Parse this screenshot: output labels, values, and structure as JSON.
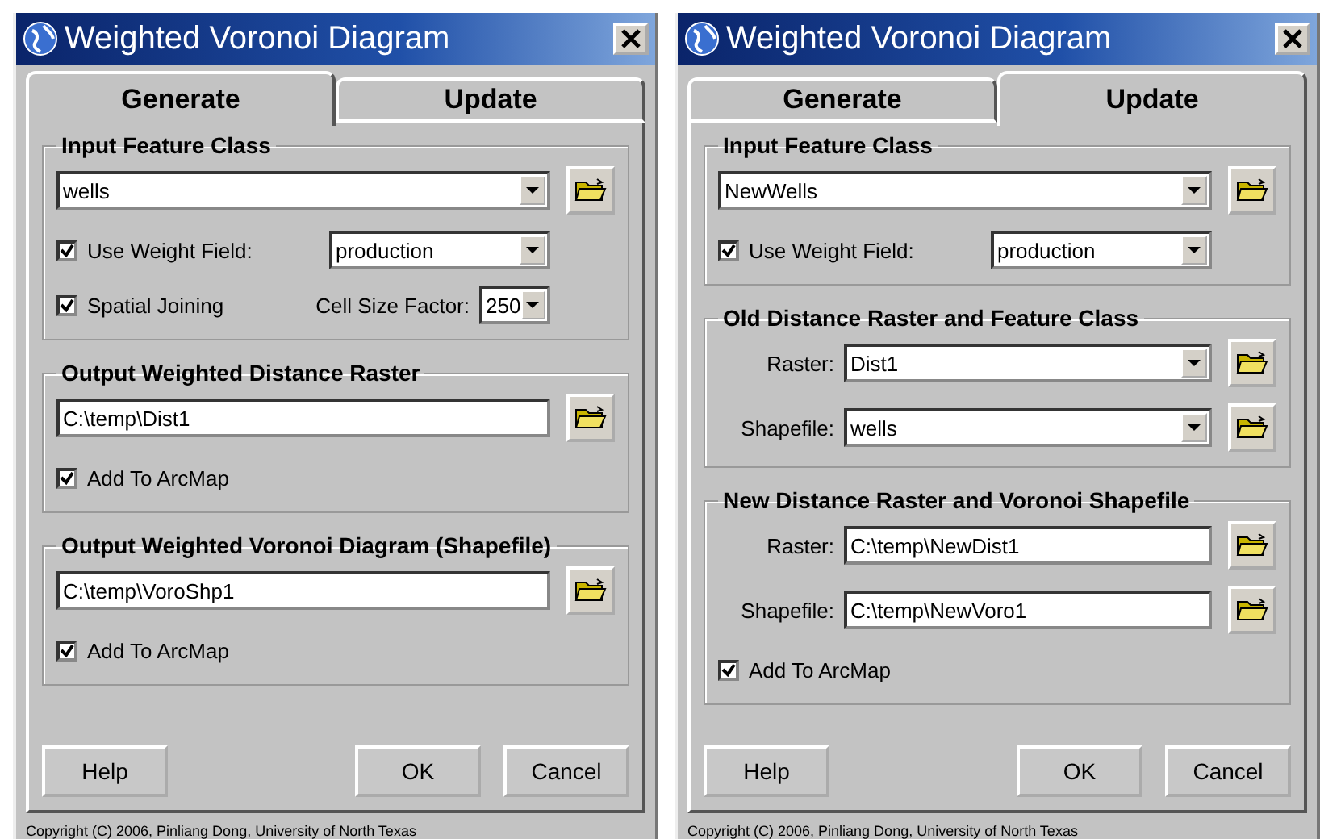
{
  "windows": [
    {
      "title": "Weighted Voronoi Diagram",
      "tabs": [
        {
          "label": "Generate",
          "selected": true
        },
        {
          "label": "Update",
          "selected": false
        }
      ],
      "groups": [
        {
          "title": "Input Feature Class",
          "rows": [
            {
              "kind": "combo",
              "value": "wells"
            },
            {
              "kind": "check",
              "label": "Use Weight Field:",
              "checked": true,
              "field": {
                "value": "production"
              }
            },
            {
              "kind": "check",
              "label": "Spatial Joining",
              "checked": true,
              "field": {
                "label": "Cell Size Factor:",
                "value": "250"
              }
            }
          ]
        },
        {
          "title": "Output Weighted Distance Raster",
          "rows": [
            {
              "kind": "text",
              "value": "C:\\temp\\Dist1"
            },
            {
              "kind": "check",
              "label": "Add To ArcMap",
              "checked": true
            }
          ]
        },
        {
          "title": "Output Weighted Voronoi Diagram (Shapefile)",
          "rows": [
            {
              "kind": "text",
              "value": "C:\\temp\\VoroShp1"
            },
            {
              "kind": "check",
              "label": "Add To ArcMap",
              "checked": true
            }
          ]
        }
      ],
      "buttons": [
        {
          "label": "Help",
          "kind": "help"
        },
        {
          "label": "OK",
          "kind": "ok"
        },
        {
          "label": "Cancel",
          "kind": "cancel"
        }
      ],
      "copyright": "Copyright (C) 2006, Pinliang Dong, University of North Texas"
    },
    {
      "title": "Weighted Voronoi Diagram",
      "tabs": [
        {
          "label": "Generate",
          "selected": false
        },
        {
          "label": "Update",
          "selected": true
        }
      ],
      "groups": [
        {
          "title": "Input Feature Class",
          "rows": [
            {
              "kind": "combo",
              "value": "NewWells"
            },
            {
              "kind": "check",
              "label": "Use Weight Field:",
              "checked": true,
              "field": {
                "value": "production"
              }
            }
          ]
        },
        {
          "title": "Old Distance Raster and Feature Class",
          "rows": [
            {
              "kind": "combo",
              "label": "Raster:",
              "value": "Dist1"
            },
            {
              "kind": "combo",
              "label": "Shapefile:",
              "value": "wells"
            }
          ]
        },
        {
          "title": "New Distance Raster and Voronoi Shapefile",
          "rows": [
            {
              "kind": "text",
              "label": "Raster:",
              "value": "C:\\temp\\NewDist1"
            },
            {
              "kind": "text",
              "label": "Shapefile:",
              "value": "C:\\temp\\NewVoro1"
            },
            {
              "kind": "check",
              "label": "Add To ArcMap",
              "checked": true
            }
          ]
        }
      ],
      "buttons": [
        {
          "label": "Help",
          "kind": "help"
        },
        {
          "label": "OK",
          "kind": "ok"
        },
        {
          "label": "Cancel",
          "kind": "cancel"
        }
      ],
      "copyright": "Copyright (C) 2006, Pinliang Dong, University of North Texas"
    }
  ]
}
